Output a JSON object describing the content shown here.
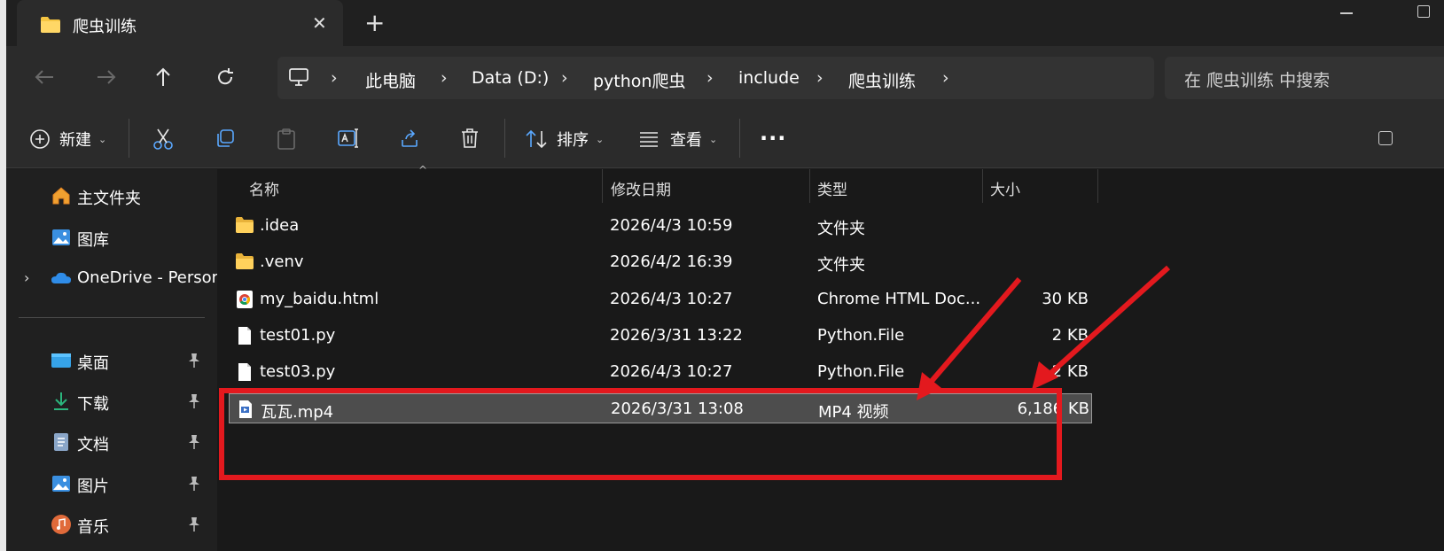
{
  "window": {
    "tab_title": "爬虫训练",
    "new_tab": "+",
    "tab_close": "✕"
  },
  "address": {
    "crumbs": [
      "此电脑",
      "Data (D:)",
      "python爬虫",
      "include",
      "爬虫训练"
    ],
    "search_placeholder": "在 爬虫训练 中搜索"
  },
  "toolbar": {
    "new_label": "新建",
    "sort_label": "排序",
    "view_label": "查看",
    "more_label": "..."
  },
  "sidebar": {
    "items": [
      {
        "label": "主文件夹",
        "icon": "home-icon"
      },
      {
        "label": "图库",
        "icon": "gallery-icon"
      },
      {
        "label": "OneDrive - Persor",
        "icon": "onedrive-icon"
      },
      {
        "label": "桌面",
        "icon": "desktop-icon"
      },
      {
        "label": "下载",
        "icon": "download-icon"
      },
      {
        "label": "文档",
        "icon": "documents-icon"
      },
      {
        "label": "图片",
        "icon": "pictures-icon"
      },
      {
        "label": "音乐",
        "icon": "music-icon"
      }
    ]
  },
  "columns": {
    "name": "名称",
    "modified": "修改日期",
    "type": "类型",
    "size": "大小"
  },
  "files": [
    {
      "name": ".idea",
      "modified": "2026/4/3 10:59",
      "type": "文件夹",
      "size": "",
      "icon": "folder-icon"
    },
    {
      "name": ".venv",
      "modified": "2026/4/2 16:39",
      "type": "文件夹",
      "size": "",
      "icon": "folder-icon"
    },
    {
      "name": "my_baidu.html",
      "modified": "2026/4/3 10:27",
      "type": "Chrome HTML Doc...",
      "size": "30 KB",
      "icon": "chrome-icon"
    },
    {
      "name": "test01.py",
      "modified": "2026/3/31 13:22",
      "type": "Python.File",
      "size": "2 KB",
      "icon": "file-icon"
    },
    {
      "name": "test03.py",
      "modified": "2026/4/3 10:27",
      "type": "Python.File",
      "size": "2 KB",
      "icon": "file-icon"
    },
    {
      "name": "瓦瓦.mp4",
      "modified": "2026/3/31 13:08",
      "type": "MP4 视频",
      "size": "6,186 KB",
      "icon": "video-file-icon",
      "selected": true
    }
  ],
  "colors": {
    "annotation": "#e3191e",
    "selection": "#4d4d4d",
    "folder": "#f5c542"
  }
}
